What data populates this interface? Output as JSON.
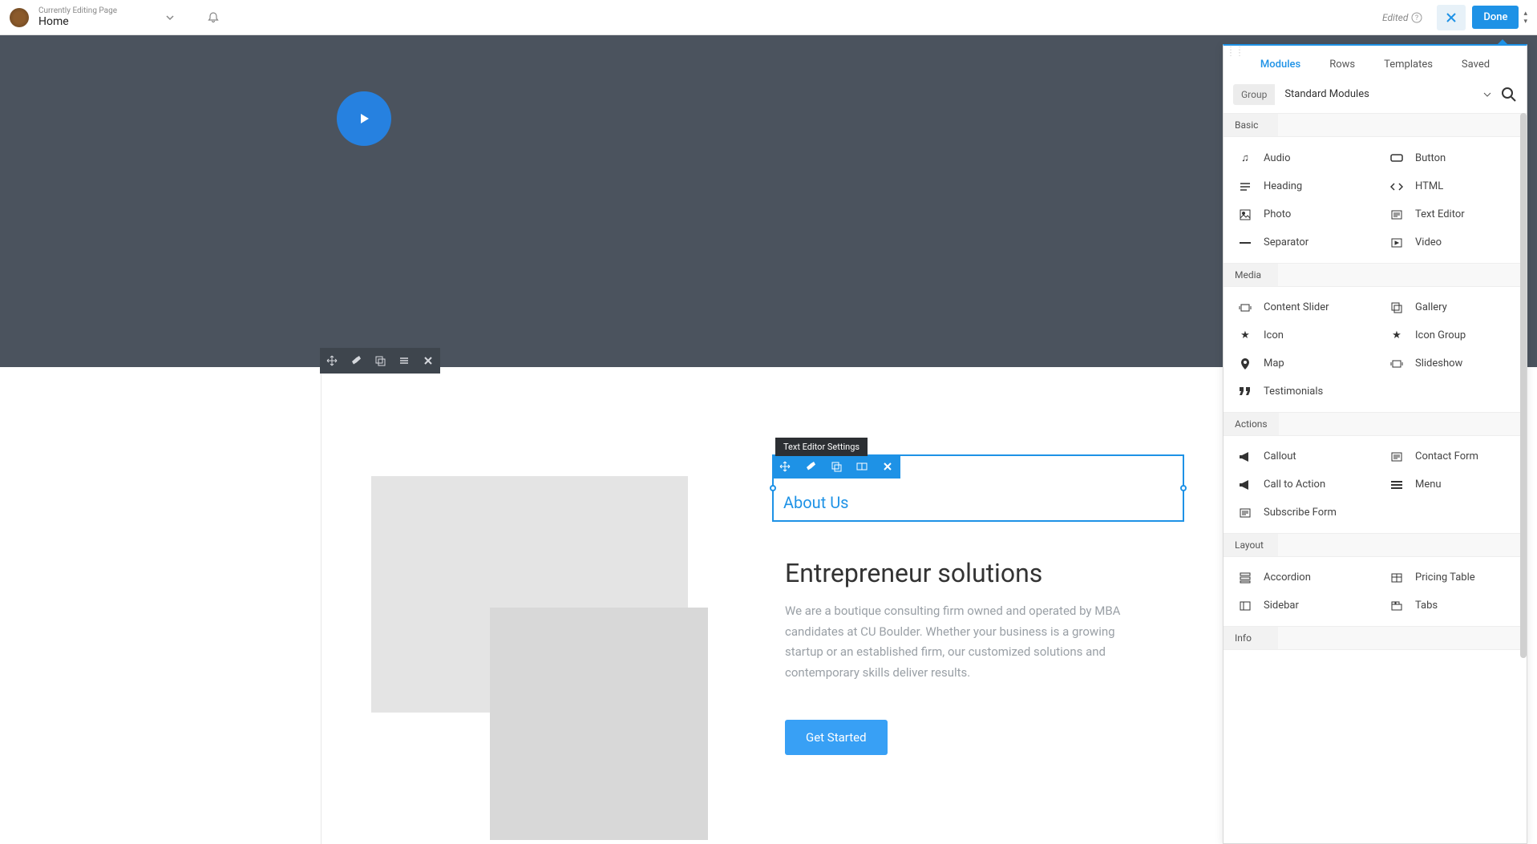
{
  "topbar": {
    "editing_label": "Currently Editing Page",
    "page_name": "Home",
    "edited_label": "Edited",
    "done_label": "Done"
  },
  "canvas": {
    "tooltip": "Text Editor Settings",
    "about_heading": "About Us",
    "main_heading": "Entrepreneur solutions",
    "body_text": "We are a boutique consulting firm owned and operated by MBA candidates at CU Boulder. Whether your business is a growing startup or an established firm, our customized solutions and contemporary skills deliver results.",
    "cta_label": "Get Started"
  },
  "panel": {
    "tabs": {
      "modules": "Modules",
      "rows": "Rows",
      "templates": "Templates",
      "saved": "Saved"
    },
    "filter": {
      "group_label": "Group",
      "selected": "Standard Modules"
    },
    "groups": {
      "basic": {
        "label": "Basic",
        "items": {
          "audio": "Audio",
          "button": "Button",
          "heading": "Heading",
          "html": "HTML",
          "photo": "Photo",
          "text_editor": "Text Editor",
          "separator": "Separator",
          "video": "Video"
        }
      },
      "media": {
        "label": "Media",
        "items": {
          "content_slider": "Content Slider",
          "gallery": "Gallery",
          "icon": "Icon",
          "icon_group": "Icon Group",
          "map": "Map",
          "slideshow": "Slideshow",
          "testimonials": "Testimonials"
        }
      },
      "actions": {
        "label": "Actions",
        "items": {
          "callout": "Callout",
          "contact_form": "Contact Form",
          "cta": "Call to Action",
          "menu": "Menu",
          "subscribe": "Subscribe Form"
        }
      },
      "layout": {
        "label": "Layout",
        "items": {
          "accordion": "Accordion",
          "pricing_table": "Pricing Table",
          "sidebar": "Sidebar",
          "tabs": "Tabs"
        }
      },
      "info": {
        "label": "Info"
      }
    }
  }
}
